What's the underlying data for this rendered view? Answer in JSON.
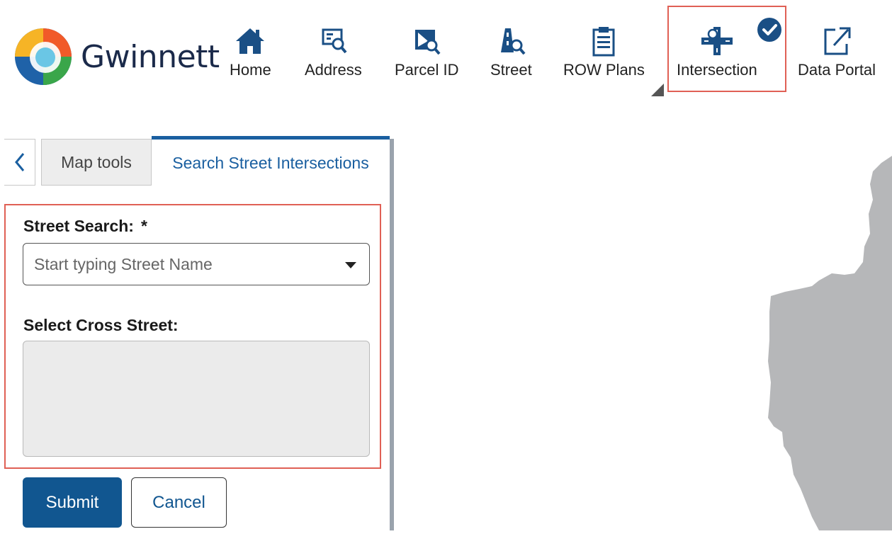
{
  "brand": {
    "name": "Gwinnett"
  },
  "nav": {
    "items": [
      {
        "label": "Home",
        "icon": "home-icon"
      },
      {
        "label": "Address",
        "icon": "address-search-icon"
      },
      {
        "label": "Parcel ID",
        "icon": "parcel-search-icon"
      },
      {
        "label": "Street",
        "icon": "street-search-icon"
      },
      {
        "label": "ROW Plans",
        "icon": "clipboard-icon"
      },
      {
        "label": "Intersection",
        "icon": "intersection-icon",
        "active": true
      },
      {
        "label": "Data Portal",
        "icon": "external-link-icon"
      }
    ]
  },
  "panel": {
    "tabs": [
      {
        "label": "Map tools"
      },
      {
        "label": "Search Street Intersections",
        "active": true
      }
    ],
    "form": {
      "street_label": "Street Search:",
      "required_mark": "*",
      "street_placeholder": "Start typing Street Name",
      "cross_label": "Select Cross Street:"
    },
    "buttons": {
      "submit": "Submit",
      "cancel": "Cancel"
    }
  },
  "colors": {
    "accent": "#1a5fa0",
    "primary_button": "#115690",
    "highlight_frame": "#e06055",
    "map_shape": "#b6b7b9"
  }
}
